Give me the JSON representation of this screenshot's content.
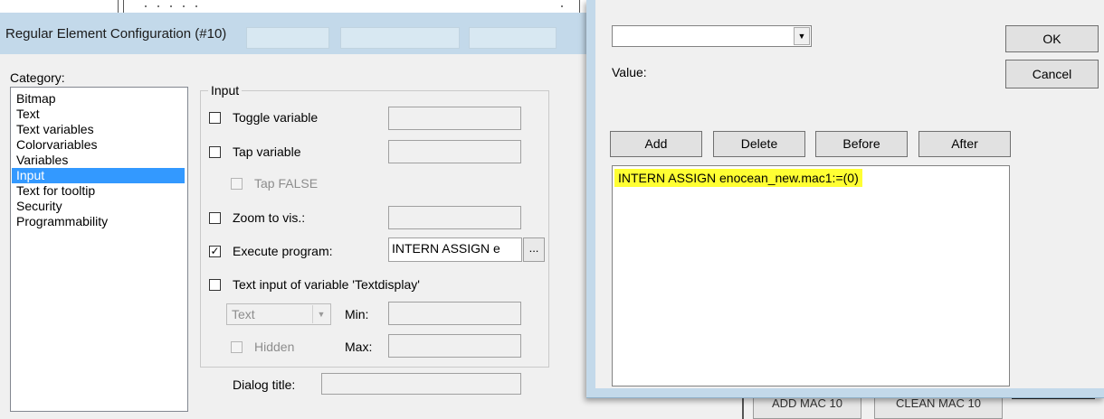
{
  "window": {
    "title": "Regular Element Configuration (#10)"
  },
  "category": {
    "label": "Category:",
    "items": [
      "Bitmap",
      "Text",
      "Text variables",
      "Colorvariables",
      "Variables",
      "Input",
      "Text for tooltip",
      "Security",
      "Programmability"
    ],
    "selected": "Input"
  },
  "input_group": {
    "legend": "Input",
    "toggle_variable": {
      "label": "Toggle variable",
      "checked": false,
      "value": ""
    },
    "tap_variable": {
      "label": "Tap variable",
      "checked": false,
      "value": ""
    },
    "tap_false": {
      "label": "Tap FALSE",
      "checked": false
    },
    "zoom_to_vis": {
      "label": "Zoom to vis.:",
      "checked": false,
      "value": ""
    },
    "execute_program": {
      "label": "Execute program:",
      "checked": true,
      "value": "INTERN ASSIGN e",
      "browse_label": "..."
    },
    "text_input": {
      "label": "Text input of variable 'Textdisplay'",
      "checked": false
    },
    "type_select": {
      "value": "Text"
    },
    "min_label": "Min:",
    "max_label": "Max:",
    "hidden": {
      "label": "Hidden",
      "checked": false
    }
  },
  "dialog_title_label": "Dialog title:",
  "program_dialog": {
    "value_label": "Value:",
    "combo_value": "",
    "ok_label": "OK",
    "cancel_label": "Cancel",
    "add_label": "Add",
    "delete_label": "Delete",
    "before_label": "Before",
    "after_label": "After",
    "program_line": "INTERN ASSIGN enocean_new.mac1:=(0)",
    "highlight_color": "#ffff33"
  },
  "background_buttons": {
    "add_mac": "ADD MAC 10",
    "clean_mac": "CLEAN MAC 10"
  }
}
